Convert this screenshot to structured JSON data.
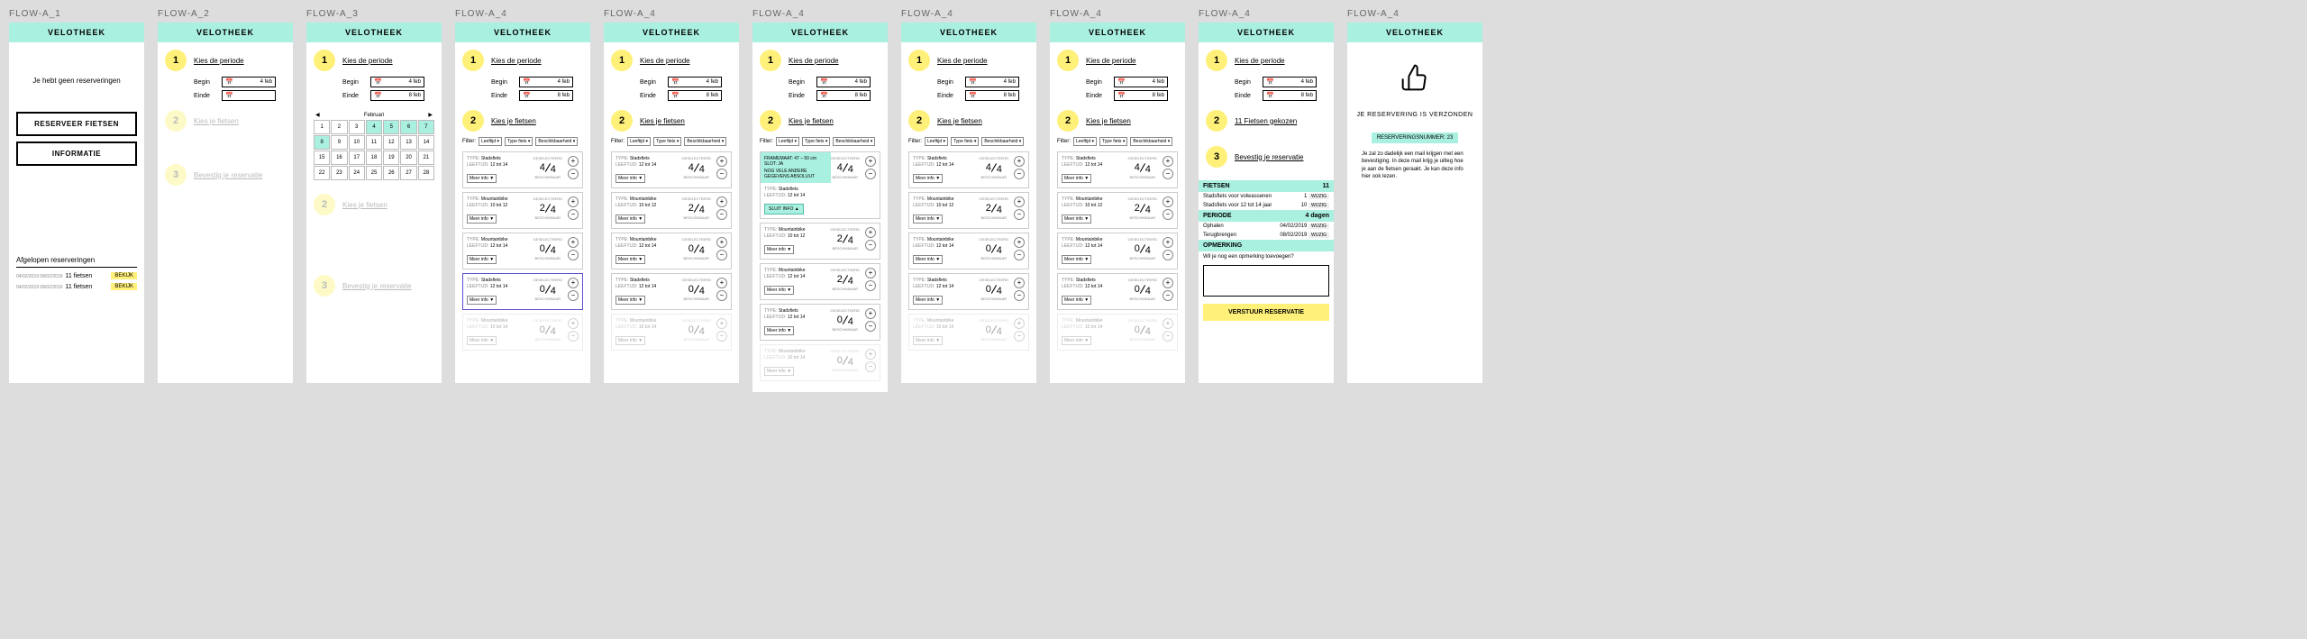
{
  "app_title": "VELOTHEEK",
  "labels": {
    "1": "FLOW-A_1",
    "2": "FLOW-A_2",
    "3": "FLOW-A_3",
    "4": "FLOW-A_4"
  },
  "s1": {
    "empty": "Je hebt geen reserveringen",
    "reserve": "RESERVEER FIETSEN",
    "info": "INFORMATIE",
    "past_title": "Afgelopen reserveringen",
    "past": [
      {
        "date": "04/02/2019 08/02/2019",
        "txt": "11 fietsen",
        "btn": "BEKIJK"
      },
      {
        "date": "04/02/2019 08/02/2019",
        "txt": "11 fietsen",
        "btn": "BEKIJK"
      }
    ]
  },
  "steps": {
    "period": "Kies de periode",
    "bikes": "Kies je fietsen",
    "confirm": "Bevestig je reservatie",
    "chosen": "11 Fietsen gekozen"
  },
  "fields": {
    "begin": "Begin",
    "einde": "Einde",
    "d1": "4 feb",
    "d2": "8 feb"
  },
  "cal": {
    "month": "Februari",
    "days": [
      1,
      2,
      3,
      4,
      5,
      6,
      7,
      8,
      9,
      10,
      11,
      12,
      13,
      14,
      15,
      16,
      17,
      18,
      19,
      20,
      21,
      22,
      23,
      24,
      25,
      26,
      27,
      28
    ]
  },
  "filter": {
    "label": "Filter:",
    "f1": "Leeftijd",
    "f2": "Type fiets",
    "f3": "Beschikbaarheid"
  },
  "bike_labels": {
    "type": "TYPE:",
    "age": "LEEFTIJD:",
    "meer": "Meer info",
    "sluit": "SLUIT INFO",
    "gesel": "GESELECTEERD",
    "besch": "BESCHIKBAAR"
  },
  "bikes": [
    {
      "type": "Stadsfiets",
      "age": "12 tot 14",
      "sel": 4,
      "av": 4
    },
    {
      "type": "Mountainbike",
      "age": "10 tot 12",
      "sel": 2,
      "av": 4
    },
    {
      "type": "Mountainbike",
      "age": "12 tot 14",
      "sel": 0,
      "av": 4
    },
    {
      "type": "Stadsfiets",
      "age": "12 tot 14",
      "sel": 0,
      "av": 4
    },
    {
      "type": "Mountainbike",
      "age": "10 tot 14",
      "sel": 0,
      "av": 4
    }
  ],
  "expand": {
    "l1": "FRAMEMAAT: 47 – 50 cm",
    "l2": "SLOT: JA",
    "l3": "NOG VELE ANDERE GEGEVENS ABSOLUUT"
  },
  "summary": {
    "fietsen_h": "FIETSEN",
    "fietsen_n": "11",
    "rows": [
      {
        "t": "Stadsfiets voor volwassenen",
        "n": "1"
      },
      {
        "t": "Stadsfiets voor 12 tot 14 jaar",
        "n": "10"
      }
    ],
    "wijzig": "WIJZIG",
    "periode_h": "PERIODE",
    "periode_v": "4 dagen",
    "prows": [
      {
        "t": "Ophalen",
        "v": "04/02/2019"
      },
      {
        "t": "Terugbrengen",
        "v": "08/02/2019"
      }
    ],
    "opm_h": "OPMERKING",
    "opm_q": "Wil je nog een opmerking toevoegen?",
    "send": "VERSTUUR RESERVATIE"
  },
  "done": {
    "msg": "JE RESERVERING IS VERZONDEN",
    "num": "RESERVERINGSNUMMER: 23",
    "desc": "Je zal zo dadelijk een mail krijgen met een bevestiging. In deze mail krijg je uitleg hoe je aan de fietsen geraakt. Je kan deze info hier ook lezen."
  }
}
